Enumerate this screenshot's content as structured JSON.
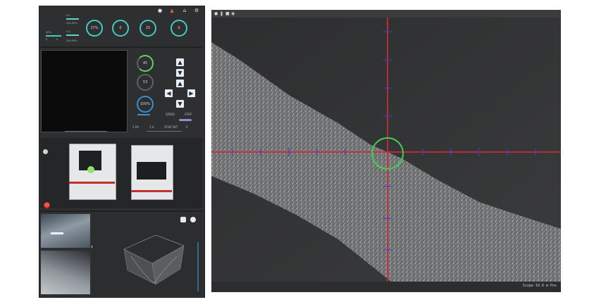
{
  "colors": {
    "panel_bg": "#2d2f31",
    "teal_accent": "#46c9c0",
    "green_accent": "#5ed25a",
    "crosshair_red": "#d02a3a",
    "crosshair_blue": "#3a3fd0",
    "reticle_green": "#3fd14a",
    "power_red": "#d0302c"
  },
  "topbar": {
    "icons": [
      "user-icon",
      "warning-icon",
      "home-icon",
      "settings-icon"
    ]
  },
  "status_block": {
    "label_a": "0.0",
    "value_a": "200.00%",
    "label_b": "40%",
    "label_c": "0.0",
    "value_c": "200.00%",
    "small_a": "0",
    "small_b": "0"
  },
  "top_gauges": [
    {
      "name": "gauge-1",
      "value": "27%"
    },
    {
      "name": "gauge-2",
      "value": "0"
    },
    {
      "name": "gauge-3",
      "value": "25"
    },
    {
      "name": "gauge-4",
      "value": "0"
    }
  ],
  "side_gauges": [
    {
      "name": "side-gauge-1",
      "value": "45"
    },
    {
      "name": "side-gauge-2",
      "value": "53"
    },
    {
      "name": "side-gauge-3",
      "value": "100%"
    }
  ],
  "controls": {
    "speed_label": "SPEED",
    "mode_label": "STEP",
    "lower_left_label": "1.0X",
    "lower_right_label": "STOP SET",
    "lower_left_value": "1.0",
    "lower_right_value": "0"
  },
  "scope": {
    "titlebar_icons": [
      "record-icon",
      "pause-icon",
      "stop-icon",
      "snapshot-icon"
    ],
    "status_text": "Scope 10.0 m  Pos"
  }
}
